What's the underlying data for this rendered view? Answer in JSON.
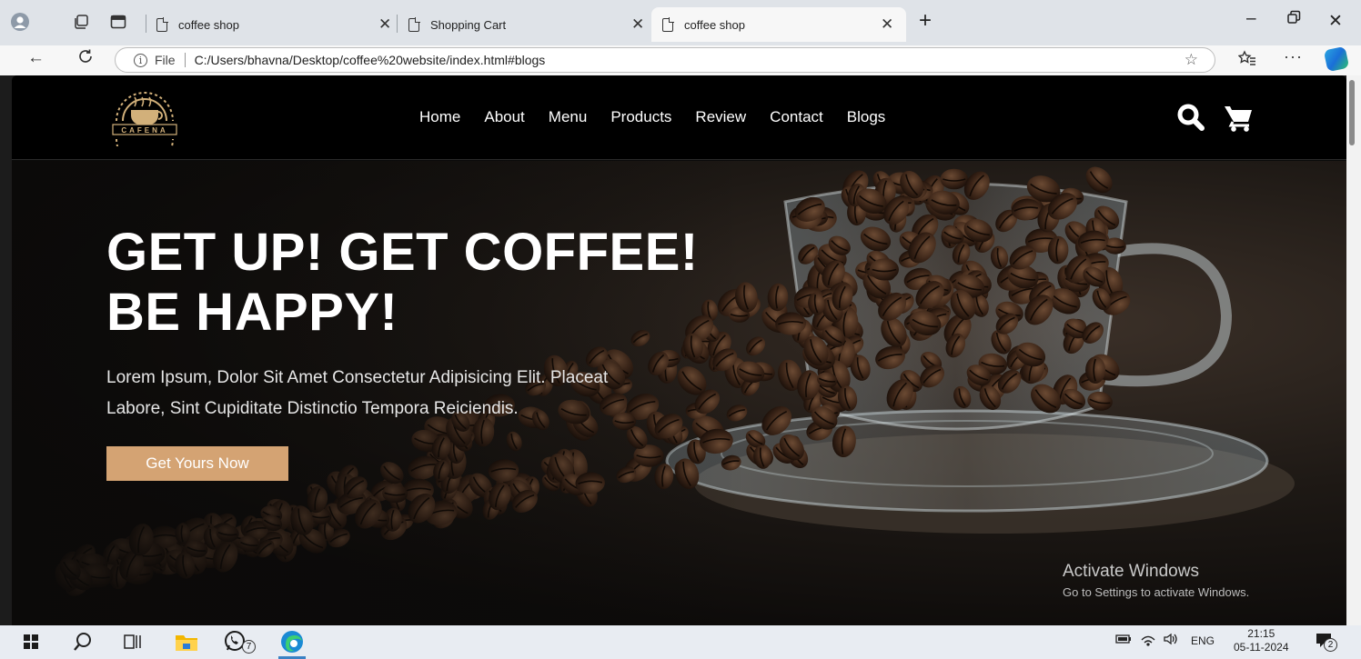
{
  "browser": {
    "tabs": [
      {
        "title": "coffee shop",
        "active": false
      },
      {
        "title": "Shopping Cart",
        "active": false
      },
      {
        "title": "coffee shop",
        "active": true
      }
    ],
    "address": {
      "scheme_label": "File",
      "url": "C:/Users/bhavna/Desktop/coffee%20website/index.html#blogs"
    },
    "icons": [
      "profile-icon",
      "workspaces-icon",
      "tab-actions-icon",
      "new-tab-icon",
      "minimize-icon",
      "restore-icon",
      "close-window-icon",
      "back-icon",
      "refresh-icon",
      "info-icon",
      "favorite-star-icon",
      "favorites-icon",
      "more-icon",
      "copilot-icon"
    ]
  },
  "site": {
    "logo_text": "CAFENA",
    "nav": [
      "Home",
      "About",
      "Menu",
      "Products",
      "Review",
      "Contact",
      "Blogs"
    ],
    "header_icons": [
      "search-icon",
      "cart-icon"
    ],
    "hero": {
      "title_line1": "GET UP! GET COFFEE!",
      "title_line2": "BE HAPPY!",
      "text_line1": "Lorem Ipsum, Dolor Sit Amet Consectetur Adipisicing Elit. Placeat",
      "text_line2": "Labore, Sint Cupiditate Distinctio Tempora Reiciendis.",
      "button": "Get Yours Now"
    },
    "colors": {
      "accent": "#d4a373",
      "header_bg": "#000000"
    }
  },
  "watermark": {
    "title": "Activate Windows",
    "subtitle": "Go to Settings to activate Windows."
  },
  "taskbar": {
    "whatsapp_badge": "7",
    "language": "ENG",
    "time": "21:15",
    "date": "05-11-2024",
    "notification_count": "2"
  }
}
